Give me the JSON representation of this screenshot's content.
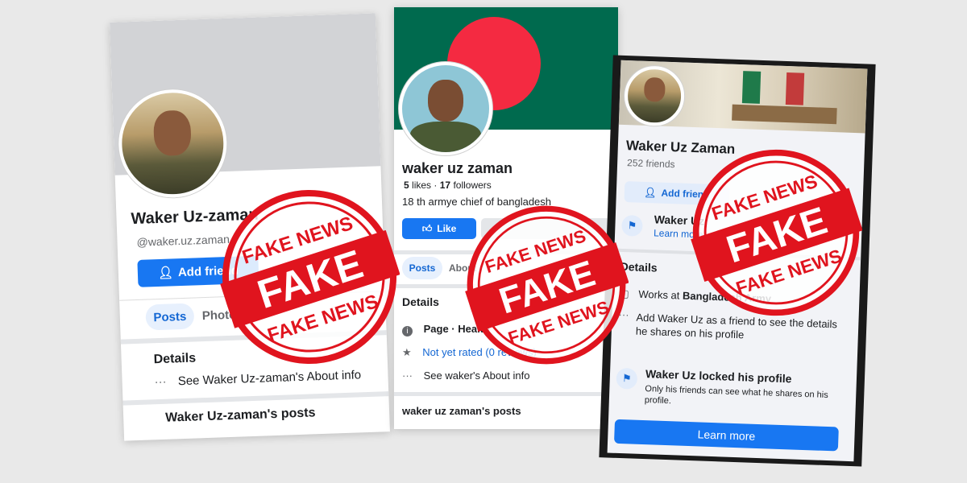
{
  "profile1": {
    "name": "Waker Uz-zaman",
    "handle": "@waker.uz.zaman",
    "add_friend": "Add friend",
    "tab_posts": "Posts",
    "tab_photos": "Photos",
    "details_heading": "Details",
    "about_link": "See Waker Uz-zaman's About info",
    "posts_heading": "Waker Uz-zaman's posts"
  },
  "profile2": {
    "name": "waker uz zaman",
    "likes_count": "5",
    "likes_label": "likes",
    "followers_count": "17",
    "followers_label": "followers",
    "bio": "18 th armye chief of bangladesh",
    "like_button": "Like",
    "tab_posts": "Posts",
    "tab_about": "About",
    "details_heading": "Details",
    "page_category": "Page · Health",
    "rating": "Not yet rated (0 reviews)",
    "about_link": "See waker's About info",
    "posts_heading": "waker uz zaman's posts",
    "cover_colors": {
      "green": "#006a4e",
      "red": "#f42a41"
    }
  },
  "profile3": {
    "name": "Waker Uz Zaman",
    "friends": "252 friends",
    "add_friend": "Add friend",
    "notice_title": "Waker Uz",
    "notice_link": "Learn more",
    "details_heading": "Details",
    "works_prefix": "Works at",
    "works_place": "Bangladesh Army",
    "add_friend_note": "Add Waker Uz as a friend to see the details he shares on his profile",
    "locked_title": "Waker Uz locked his profile",
    "locked_desc": "Only his friends can see what he shares on his profile.",
    "learn_more": "Learn more"
  },
  "stamps": {
    "top_text": "FAKE NEWS",
    "center_text": "FAKE",
    "bottom_text": "FAKE NEWS",
    "color": "#e0141e"
  },
  "theme": {
    "facebook_blue": "#1877f2"
  }
}
